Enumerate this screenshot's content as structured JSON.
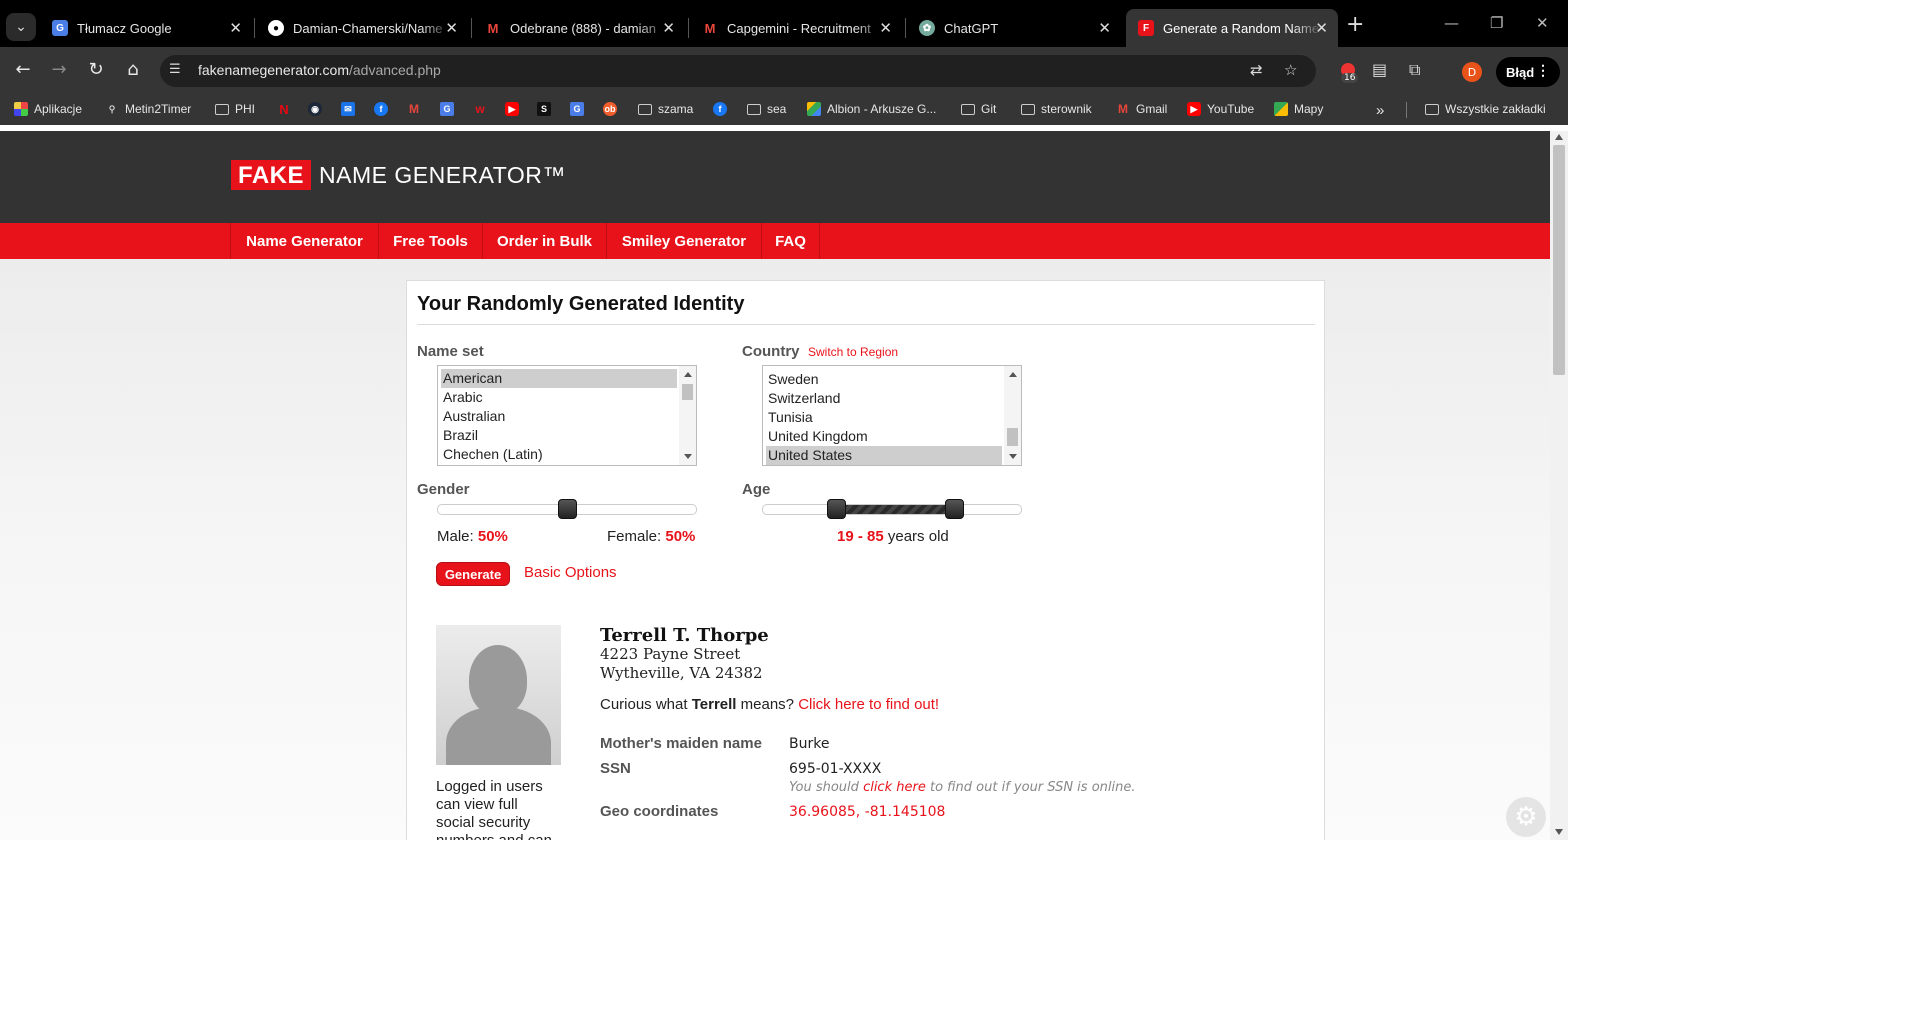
{
  "browser": {
    "tabs": [
      {
        "title": "Tłumacz Google",
        "icon": "google-translate-icon"
      },
      {
        "title": "Damian-Chamerski/Name",
        "icon": "github-icon"
      },
      {
        "title": "Odebrane (888) - damian",
        "icon": "gmail-icon"
      },
      {
        "title": "Capgemini - Recruitment",
        "icon": "gmail-icon"
      },
      {
        "title": "ChatGPT",
        "icon": "chatgpt-icon"
      },
      {
        "title": "Generate a Random Name",
        "icon": "fake-name-generator-icon"
      }
    ],
    "url_domain": "fakenamegenerator.com",
    "url_path": "/advanced.php",
    "extension_badge": "16",
    "profile_initial": "D",
    "error_chip": "Błąd",
    "bookmarks": [
      "Aplikacje",
      "Metin2Timer",
      "PHI",
      "szama",
      "sea",
      "Albion - Arkusze G...",
      "Git",
      "sterownik",
      "Gmail",
      "YouTube",
      "Mapy",
      "Wszystkie zakładki"
    ]
  },
  "site": {
    "logo_fake": "FAKE",
    "logo_rest": "NAME GENERATOR™",
    "nav": [
      "Name Generator",
      "Free Tools",
      "Order in Bulk",
      "Smiley Generator",
      "FAQ"
    ]
  },
  "generator": {
    "title": "Your Randomly Generated Identity",
    "name_set_label": "Name set",
    "name_sets": [
      "American",
      "Arabic",
      "Australian",
      "Brazil",
      "Chechen (Latin)"
    ],
    "name_set_selected": "American",
    "country_label": "Country",
    "switch_region": "Switch to Region",
    "countries": [
      "Sweden",
      "Switzerland",
      "Tunisia",
      "United Kingdom",
      "United States"
    ],
    "country_selected": "United States",
    "gender_label": "Gender",
    "male_label": "Male:",
    "male_pct": "50%",
    "female_label": "Female:",
    "female_pct": "50%",
    "gender_male_fraction": 0.5,
    "age_label": "Age",
    "age_range": "19 - 85",
    "age_suffix": "years old",
    "age_min": 19,
    "age_max": 85,
    "generate_button": "Generate",
    "basic_options": "Basic Options"
  },
  "identity": {
    "name": "Terrell T. Thorpe",
    "street": "4223 Payne Street",
    "city_line": "Wytheville, VA 24382",
    "curious_pre": "Curious what",
    "first_name": "Terrell",
    "curious_post": "means?",
    "curious_link": "Click here to find out!",
    "login_note": "Logged in users can view full social security numbers and can save their fake",
    "maiden_label": "Mother's maiden name",
    "maiden_value": "Burke",
    "ssn_label": "SSN",
    "ssn_value": "695-01-XXXX",
    "ssn_note_pre": "You should",
    "ssn_note_link": "click here",
    "ssn_note_post": "to find out if your SSN is online.",
    "geo_label": "Geo coordinates",
    "geo_value": "36.96085, -81.145108"
  }
}
